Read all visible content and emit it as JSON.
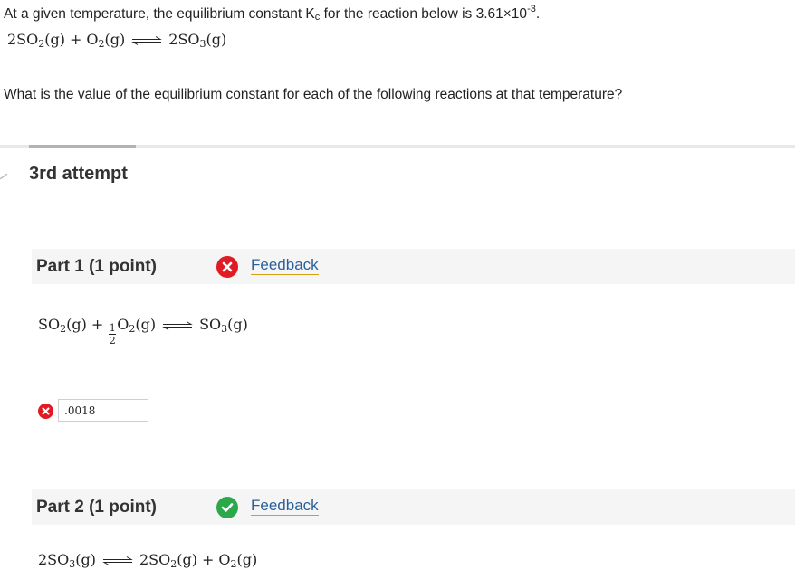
{
  "question": {
    "intro": "At a given temperature, the equilibrium constant K",
    "kc_sub": "c",
    "intro_mid": " for the reaction below is 3.61×10",
    "kc_exp": "-3",
    "intro_end": ".",
    "main_reaction": {
      "c1": "2SO",
      "s1": "2",
      "st1": "(g)",
      "plus": "+",
      "c2": "O",
      "s2": "2",
      "st2": "(g)",
      "c3": "2SO",
      "s3": "3",
      "st3": "(g)"
    },
    "prompt": "What is the value of the equilibrium constant for each of the following reactions at that temperature?"
  },
  "attempt_label": "3rd attempt",
  "parts": [
    {
      "title": "Part 1   (1 point)",
      "status": "incorrect",
      "feedback_label": "Feedback",
      "reaction": {
        "c1": "SO",
        "s1": "2",
        "st1": "(g)",
        "plus": "+",
        "frac_num": "1",
        "frac_den": "2",
        "c2": "O",
        "s2": "2",
        "st2": "(g)",
        "c3": "SO",
        "s3": "3",
        "st3": "(g)"
      },
      "answer_value": ".0018"
    },
    {
      "title": "Part 2   (1 point)",
      "status": "correct",
      "feedback_label": "Feedback",
      "reaction": {
        "c1": "2SO",
        "s1": "3",
        "st1": "(g)",
        "c2": "2SO",
        "s2": "2",
        "st2": "(g)",
        "plus": "+",
        "c3": "O",
        "s3": "2",
        "st3": "(g)"
      }
    }
  ],
  "colors": {
    "incorrect": "#e01b24",
    "correct": "#2ba84a",
    "link": "#2a5f99",
    "link_underline": "#d4a017"
  }
}
